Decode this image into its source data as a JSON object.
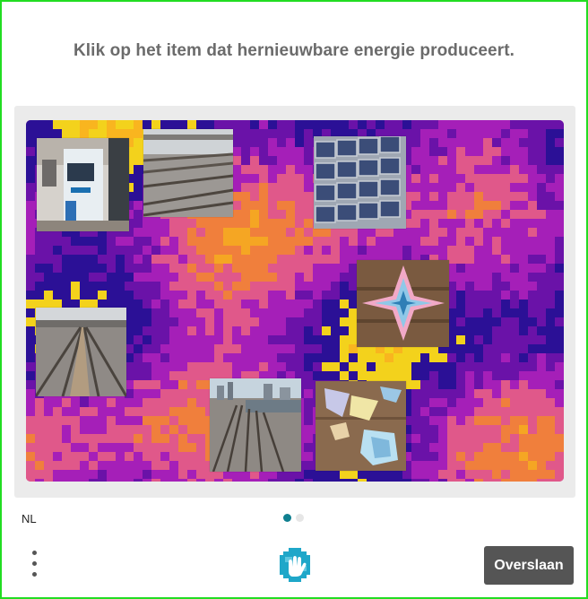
{
  "challenge": {
    "prompt": "Klik op het item dat hernieuwbare energie produceert."
  },
  "tiles": [
    {
      "id": "atm-kiosk",
      "depicts": "ticket-machine"
    },
    {
      "id": "railway-tracks-1",
      "depicts": "railway-tracks"
    },
    {
      "id": "solar-panels",
      "depicts": "solar-panels"
    },
    {
      "id": "origami-flower",
      "depicts": "origami"
    },
    {
      "id": "railway-tracks-2",
      "depicts": "railway-tracks"
    },
    {
      "id": "railway-city",
      "depicts": "railway-tracks-city"
    },
    {
      "id": "origami-pieces",
      "depicts": "origami"
    }
  ],
  "footer": {
    "language": "NL",
    "skip_label": "Overslaan",
    "page_indicator": {
      "current": 1,
      "total": 2
    },
    "logo_icon": "hcaptcha-hand-icon"
  },
  "colors": {
    "frame_border": "#22dd22",
    "prompt_text": "#6b6b6b",
    "stage_bg": "#ebebeb",
    "skip_bg": "#555555",
    "dot_active": "#0f7f8f",
    "dot_inactive": "#e6e6e6"
  }
}
